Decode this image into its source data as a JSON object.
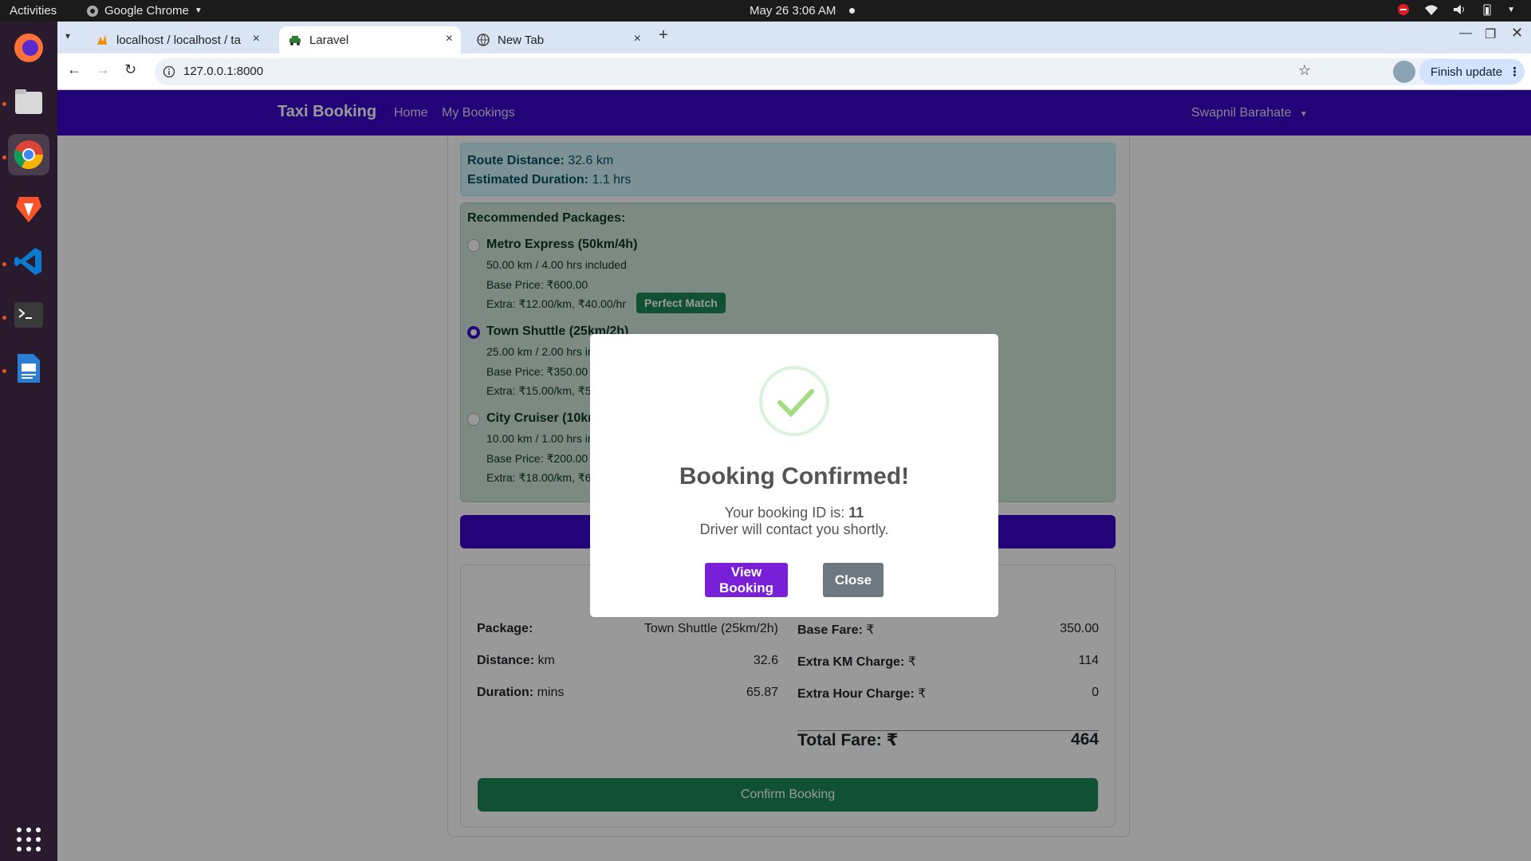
{
  "system": {
    "activities": "Activities",
    "app_name": "Google Chrome",
    "clock": "May 26  3:06 AM"
  },
  "browser": {
    "tabs": [
      {
        "label": "localhost / localhost / ta",
        "active": false
      },
      {
        "label": "Laravel",
        "active": true
      },
      {
        "label": "New Tab",
        "active": false
      }
    ],
    "url": "127.0.0.1:8000",
    "finish_update": "Finish update"
  },
  "navbar": {
    "brand": "Taxi Booking",
    "links": [
      "Home",
      "My Bookings"
    ],
    "user": "Swapnil Barahate"
  },
  "route": {
    "distance_label": "Route Distance:",
    "distance_value": "32.6 km",
    "duration_label": "Estimated Duration:",
    "duration_value": "1.1 hrs"
  },
  "packages": {
    "title": "Recommended Packages:",
    "items": [
      {
        "name": "Metro Express (50km/4h)",
        "included": "50.00 km / 4.00 hrs included",
        "base": "Base Price: ₹600.00",
        "extra": "Extra: ₹12.00/km, ₹40.00/hr",
        "badge": "Perfect Match",
        "selected": false
      },
      {
        "name": "Town Shuttle (25km/2h)",
        "included": "25.00 km / 2.00 hrs in",
        "base": "Base Price: ₹350.00",
        "extra": "Extra: ₹15.00/km, ₹5",
        "selected": true
      },
      {
        "name": "City Cruiser (10kr",
        "included": "10.00 km / 1.00 hrs in",
        "base": "Base Price: ₹200.00",
        "extra": "Extra: ₹18.00/km, ₹6",
        "selected": false
      }
    ]
  },
  "summary": {
    "left": [
      {
        "label": "Package:",
        "unit": "",
        "value": "Town Shuttle (25km/2h)"
      },
      {
        "label": "Distance:",
        "unit": "km",
        "value": "32.6"
      },
      {
        "label": "Duration:",
        "unit": "mins",
        "value": "65.87"
      }
    ],
    "right": [
      {
        "label": "Base Fare:",
        "unit": "₹",
        "value": "350.00"
      },
      {
        "label": "Extra KM Charge:",
        "unit": "₹",
        "value": "114"
      },
      {
        "label": "Extra Hour Charge:",
        "unit": "₹",
        "value": "0"
      }
    ],
    "total_label": "Total Fare: ₹",
    "total_value": "464",
    "confirm_label": "Confirm Booking"
  },
  "modal": {
    "title": "Booking Confirmed!",
    "id_prefix": "Your booking ID is: ",
    "booking_id": "11",
    "message": "Driver will contact you shortly.",
    "view_label": "View Booking",
    "close_label": "Close"
  }
}
